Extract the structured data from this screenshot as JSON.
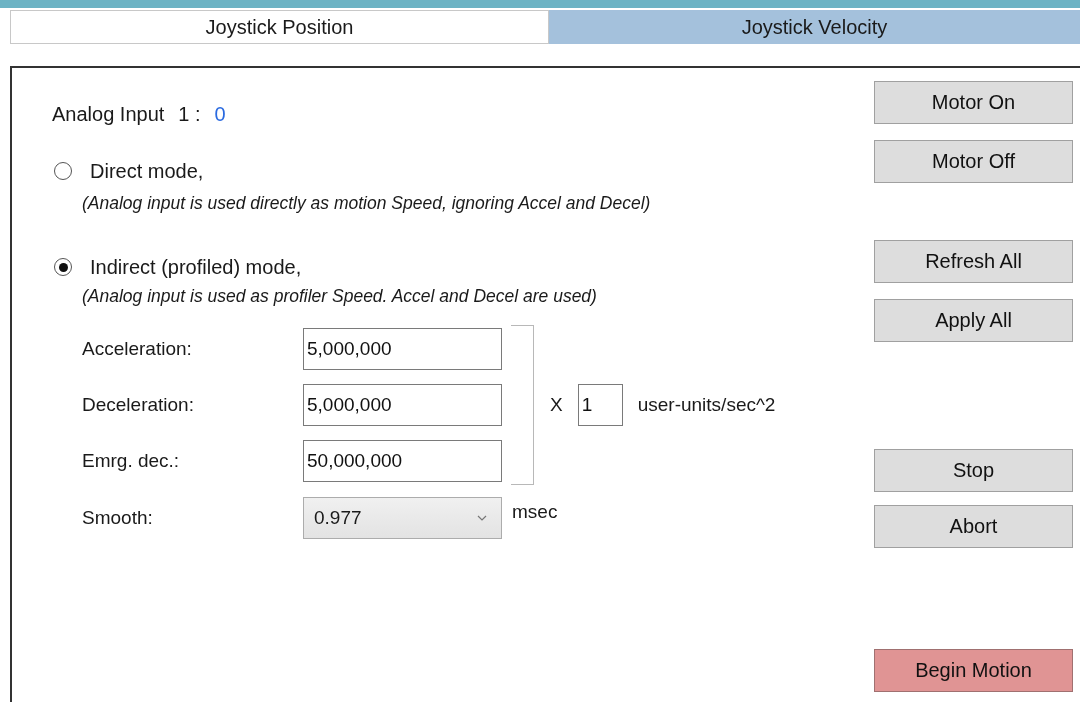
{
  "tabs": [
    {
      "label": "Joystick Position",
      "selected": true
    },
    {
      "label": "Joystick Velocity",
      "selected": false
    }
  ],
  "analog_input": {
    "label": "Analog Input",
    "channel": "1 :",
    "value": "0"
  },
  "modes": [
    {
      "label": "Direct mode,",
      "selected": false,
      "description": "(Analog input is used directly as motion Speed, ignoring Accel and Decel)"
    },
    {
      "label": "Indirect (profiled) mode,",
      "selected": true,
      "description": "(Analog input is used as profiler Speed. Accel and Decel are used)"
    }
  ],
  "parameters": [
    {
      "label": "Acceleration:",
      "value": "5,000,000"
    },
    {
      "label": "Deceleration:",
      "value": "5,000,000"
    },
    {
      "label": "Emrg. dec.:",
      "value": "50,000,000"
    }
  ],
  "multiplier": {
    "sign": "X",
    "value": "1",
    "unit": "user-units/sec^2"
  },
  "smooth": {
    "label": "Smooth:",
    "value": "0.977",
    "unit": "msec"
  },
  "button_groups": [
    [
      {
        "label": "Motor On",
        "kind": "normal"
      },
      {
        "label": "Motor Off",
        "kind": "normal"
      }
    ],
    [
      {
        "label": "Refresh All",
        "kind": "normal"
      },
      {
        "label": "Apply All",
        "kind": "normal"
      }
    ],
    [
      {
        "label": "Stop",
        "kind": "normal"
      },
      {
        "label": "Abort",
        "kind": "normal"
      }
    ],
    [
      {
        "label": "Begin Motion",
        "kind": "accent"
      }
    ]
  ]
}
